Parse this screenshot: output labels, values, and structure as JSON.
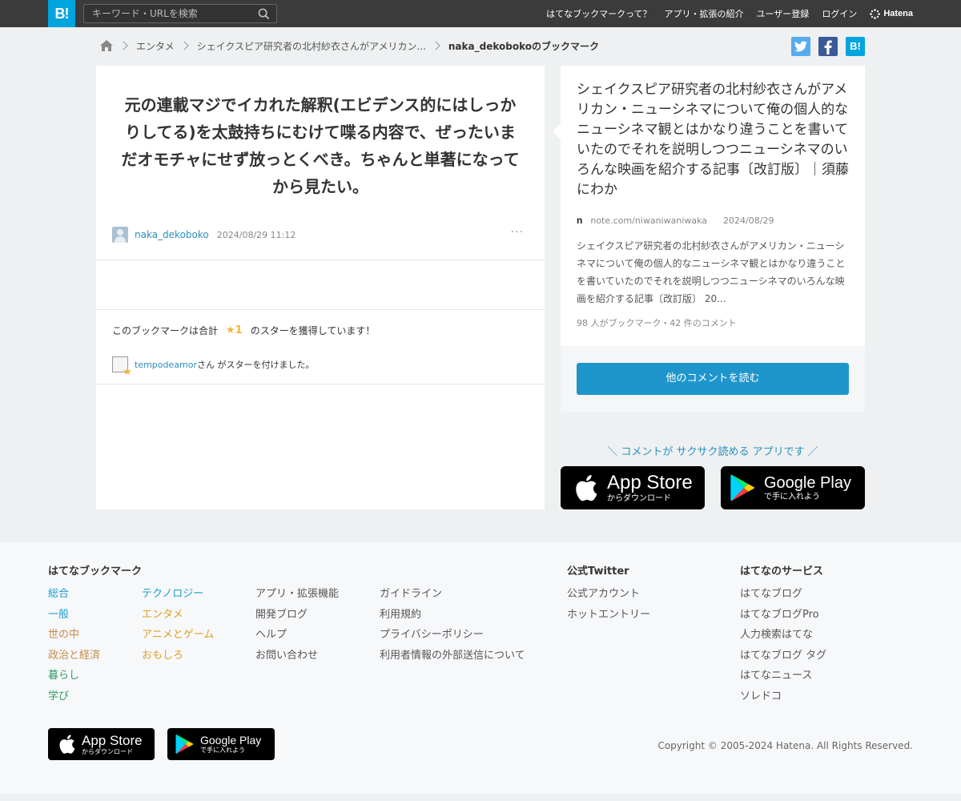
{
  "header": {
    "logo": "B!",
    "search_placeholder": "キーワード・URLを検索",
    "nav": [
      "はてなブックマークって？",
      "アプリ・拡張の紹介",
      "ユーザー登録",
      "ログイン"
    ],
    "brand": "Hatena"
  },
  "breadcrumb": {
    "category": "エンタメ",
    "entry": "シェイクスピア研究者の北村紗衣さんがアメリカン...",
    "current": "naka_dekobokoのブックマーク"
  },
  "share": {
    "hatena": "B!"
  },
  "comment": {
    "text": "元の連載マジでイカれた解釈(エビデンス的にはしっかりしてる)を太鼓持ちにむけて喋る内容で、ぜったいまだオモチャにせず放っとくべき。ちゃんと単著になってから見たい。",
    "user": "naka_dekoboko",
    "date": "2024/08/29 11:12",
    "more": "···"
  },
  "stars": {
    "summary_prefix": "このブックマークは合計",
    "count": "★1",
    "summary_suffix": "のスターを獲得しています！",
    "star_user": "tempodeamor",
    "star_user_suffix": "さん がスターを付けました。"
  },
  "entry": {
    "title": "シェイクスピア研究者の北村紗衣さんがアメリカン・ニューシネマについて俺の個人的なニューシネマ観とはかなり違うことを書いていたのでそれを説明しつつニューシネマのいろんな映画を紹介する記事〔改訂版〕｜須藤にわか",
    "site_icon": "n",
    "domain": "note.com/niwaniwaniwaka",
    "date": "2024/08/29",
    "description": "シェイクスピア研究者の北村紗衣さんがアメリカン・ニューシネマについて俺の個人的なニューシネマ観とはかなり違うことを書いていたのでそれを説明しつつニューシネマのいろんな映画を紹介する記事〔改訂版〕 20...",
    "stats": "98 人がブックマーク・42 件のコメント",
    "read_button": "他のコメントを読む"
  },
  "promo": {
    "caption": "＼ コメントが サクサク読める アプリです ／",
    "appstore_big": "App Store",
    "appstore_small": "からダウンロード",
    "googleplay_big": "Google Play",
    "googleplay_small": "で手に入れよう"
  },
  "footer": {
    "bookmark_heading": "はてなブックマーク",
    "categories_col1": [
      "総合",
      "一般",
      "世の中",
      "政治と経済",
      "暮らし",
      "学び"
    ],
    "categories_col2": [
      "テクノロジー",
      "エンタメ",
      "アニメとゲーム",
      "おもしろ"
    ],
    "links_col3": [
      "アプリ・拡張機能",
      "開発ブログ",
      "ヘルプ",
      "お問い合わせ"
    ],
    "links_col4": [
      "ガイドライン",
      "利用規約",
      "プライバシーポリシー",
      "利用者情報の外部送信について"
    ],
    "twitter_heading": "公式Twitter",
    "twitter_links": [
      "公式アカウント",
      "ホットエントリー"
    ],
    "services_heading": "はてなのサービス",
    "services_links": [
      "はてなブログ",
      "はてなブログPro",
      "人力検索はてな",
      "はてなブログ タグ",
      "はてなニュース",
      "ソレドコ"
    ],
    "copyright": "Copyright © 2005-2024 Hatena. All Rights Reserved."
  },
  "colors": {
    "header_bg": "#3b3b3b",
    "logo_bg": "#00a4de",
    "link_blue": "#2b8fc0",
    "button_blue": "#1e96cc",
    "star_yellow": "#f0b43c",
    "twitter": "#1da1f2",
    "facebook": "#3b5998",
    "cat_colors_col1": [
      "#1a9ed0",
      "#1a9ed0",
      "#c58a45",
      "#c58a45",
      "#2e9a5e",
      "#2e9a5e"
    ],
    "cat_colors_col2": [
      "#1a9ed0",
      "#e0a020",
      "#e0a020",
      "#e0a020"
    ]
  }
}
